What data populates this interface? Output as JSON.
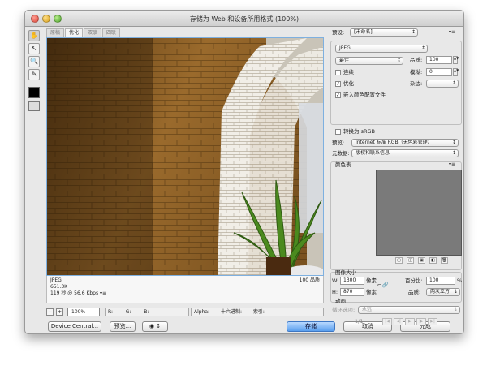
{
  "window": {
    "title": "存储为 Web 和设备所用格式 (100%)"
  },
  "tools": [
    "hand-icon",
    "slice-select-icon",
    "zoom-icon",
    "eyedropper-icon"
  ],
  "tabs": [
    {
      "label": "原稿"
    },
    {
      "label": "优化"
    },
    {
      "label": "双联"
    },
    {
      "label": "四联"
    }
  ],
  "preview_info": {
    "format": "JPEG",
    "size": "651.3K",
    "time": "119 秒 @ 56.6 Kbps",
    "arrow": "▾≡",
    "quality": "100 品质"
  },
  "status": {
    "zoom_minus": "−",
    "zoom_plus": "+",
    "zoom": "100%",
    "r": "R: --",
    "g": "G: --",
    "b": "B: --",
    "alpha": "Alpha: --",
    "hex": "十六进制: --",
    "index": "索引: --"
  },
  "buttons": {
    "device_central": "Device Central...",
    "preview": "预览...",
    "save": "存储",
    "cancel": "取消",
    "done": "完成"
  },
  "settings": {
    "preset_label": "预设:",
    "preset_value": "[未命名]",
    "format": "JPEG",
    "quality_preset": "最佳",
    "quality_label": "品质:",
    "quality_value": "100",
    "progressive": "连续",
    "blur_label": "模糊:",
    "blur_value": "0",
    "optimized": "优化",
    "matte_label": "杂边:",
    "embed_profile": "嵌入颜色配置文件",
    "convert_srgb": "转换为 sRGB",
    "preview_label": "预览:",
    "preview_value": "Internet 标准 RGB（无色彩管理）",
    "metadata_label": "元数据:",
    "metadata_value": "版权和联系信息"
  },
  "color_table": {
    "title": "颜色表"
  },
  "image_size": {
    "title": "图像大小",
    "w_label": "W:",
    "w_value": "1300",
    "h_label": "H:",
    "h_value": "870",
    "unit": "像素",
    "percent_label": "百分比:",
    "percent_value": "100",
    "percent_sign": "%",
    "quality_label": "品质:",
    "quality_value": "两次立方"
  },
  "animation": {
    "title": "动画",
    "loop_label": "循环选项:",
    "loop_value": "永远",
    "frame": "1/1"
  }
}
